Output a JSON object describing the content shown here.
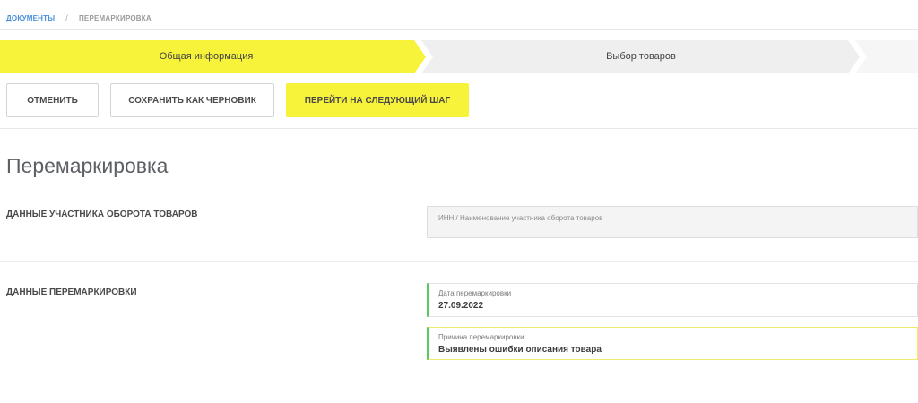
{
  "breadcrumb": {
    "parent": "ДОКУМЕНТЫ",
    "separator": "/",
    "current": "ПЕРЕМАРКИРОВКА"
  },
  "steps": [
    {
      "label": "Общая информация",
      "active": true
    },
    {
      "label": "Выбор товаров",
      "active": false
    }
  ],
  "actions": {
    "cancel": "ОТМЕНИТЬ",
    "save_draft": "СОХРАНИТЬ КАК ЧЕРНОВИК",
    "next_step": "ПЕРЕЙТИ НА СЛЕДУЮЩИЙ ШАГ"
  },
  "page_title": "Перемаркировка",
  "sections": {
    "participant": {
      "label": "ДАННЫЕ УЧАСТНИКА ОБОРОТА ТОВАРОВ",
      "field_placeholder": "ИНН / Наименование участника оборота товаров"
    },
    "remarking": {
      "label": "ДАННЫЕ ПЕРЕМАРКИРОВКИ",
      "date_label": "Дата перемаркировки",
      "date_value": "27.09.2022",
      "reason_label": "Причина перемаркировки",
      "reason_value": "Выявлены ошибки описания товара"
    }
  },
  "colors": {
    "accent_yellow": "#f7f23a",
    "valid_green": "#5cc860",
    "link_blue": "#4a90d9"
  }
}
